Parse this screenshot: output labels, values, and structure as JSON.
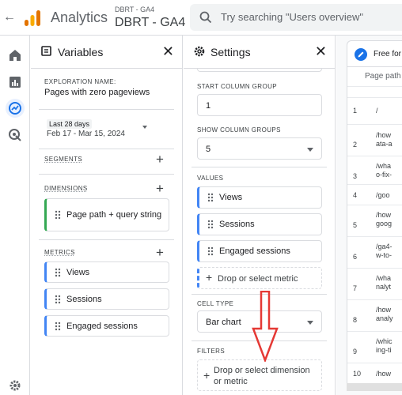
{
  "header": {
    "app_title": "Analytics",
    "property_small": "DBRT - GA4",
    "property_name": "DBRT - GA4",
    "search_placeholder": "Try searching \"Users overview\""
  },
  "variables_panel": {
    "title": "Variables",
    "exploration_label": "EXPLORATION NAME:",
    "exploration_name": "Pages with zero pageviews",
    "date_range_label": "Last 28 days",
    "date_range": "Feb 17 - Mar 15, 2024",
    "segments_label": "SEGMENTS",
    "dimensions_label": "DIMENSIONS",
    "dimensions": [
      "Page path + query string"
    ],
    "metrics_label": "METRICS",
    "metrics": [
      "Views",
      "Sessions",
      "Engaged sessions"
    ]
  },
  "settings_panel": {
    "title": "Settings",
    "start_column_group_label": "START COLUMN GROUP",
    "start_column_group_value": "1",
    "show_column_groups_label": "SHOW COLUMN GROUPS",
    "show_column_groups_value": "5",
    "values_label": "VALUES",
    "values": [
      "Views",
      "Sessions",
      "Engaged sessions"
    ],
    "drop_metric": "Drop or select metric",
    "cell_type_label": "CELL TYPE",
    "cell_type_value": "Bar chart",
    "filters_label": "FILTERS",
    "drop_dimension": "Drop or select dimension or metric"
  },
  "table_panel": {
    "tab_label": "Free for",
    "column_header": "Page path",
    "rows": [
      {
        "n": "1",
        "text": "/"
      },
      {
        "n": "2",
        "text": "/how\nata-a"
      },
      {
        "n": "3",
        "text": "/wha\no-fix-"
      },
      {
        "n": "4",
        "text": "/goo"
      },
      {
        "n": "5",
        "text": "/how\ngoog"
      },
      {
        "n": "6",
        "text": "/ga4-\nw-to-"
      },
      {
        "n": "7",
        "text": "/wha\nnalyt"
      },
      {
        "n": "8",
        "text": "/how\nanaly"
      },
      {
        "n": "9",
        "text": "/whic\ning-ti"
      },
      {
        "n": "10",
        "text": "/how"
      }
    ]
  },
  "colors": {
    "accent_blue": "#1a73e8",
    "dimension_green": "#34a853",
    "metric_blue": "#4285f4",
    "annotation_red": "#e53935"
  }
}
